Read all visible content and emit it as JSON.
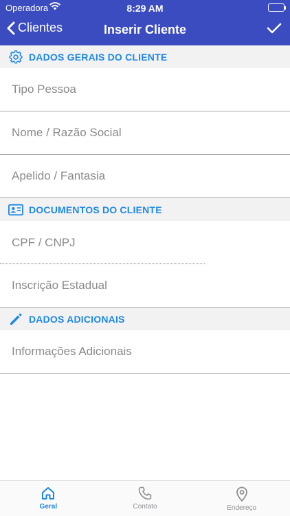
{
  "status_bar": {
    "carrier": "Operadora",
    "time": "8:29 AM"
  },
  "nav": {
    "back_label": "Clientes",
    "title": "Inserir Cliente"
  },
  "sections": {
    "general": {
      "title": "DADOS GERAIS DO CLIENTE",
      "fields": [
        {
          "placeholder": "Tipo Pessoa"
        },
        {
          "placeholder": "Nome / Razão Social"
        },
        {
          "placeholder": "Apelido / Fantasia"
        }
      ]
    },
    "documents": {
      "title": "DOCUMENTOS DO CLIENTE",
      "fields": [
        {
          "placeholder": "CPF / CNPJ"
        },
        {
          "placeholder": "Inscrição Estadual"
        }
      ]
    },
    "additional": {
      "title": "DADOS ADICIONAIS",
      "fields": [
        {
          "placeholder": "Informações Adicionais"
        }
      ]
    }
  },
  "tabs": [
    {
      "label": "Geral",
      "icon": "home-icon",
      "active": true
    },
    {
      "label": "Contato",
      "icon": "phone-icon",
      "active": false
    },
    {
      "label": "Endereço",
      "icon": "map-pin-icon",
      "active": false
    }
  ],
  "colors": {
    "header": "#3b4cc0",
    "accent": "#1e88e5",
    "section_bg": "#f2f2f2"
  }
}
